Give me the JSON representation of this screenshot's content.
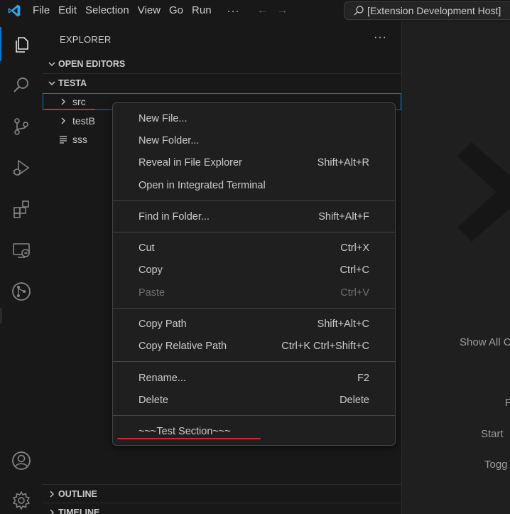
{
  "titlebar": {
    "menus": [
      "File",
      "Edit",
      "Selection",
      "View",
      "Go",
      "Run"
    ],
    "more": "···",
    "back": "←",
    "forward": "→",
    "command_center": "[Extension Development Host]"
  },
  "activitybar": {
    "items": [
      "explorer-icon",
      "search-icon",
      "source-control-icon",
      "run-debug-icon",
      "extensions-icon",
      "remote-explorer-icon",
      "git-graph-icon"
    ],
    "bottom": [
      "account-icon",
      "manage-gear-icon"
    ]
  },
  "sidebar": {
    "title": "EXPLORER",
    "more": "···",
    "open_editors": "OPEN EDITORS",
    "workspace": "TESTA",
    "tree": [
      {
        "name": "src",
        "type": "folder"
      },
      {
        "name": "testB",
        "type": "folder"
      },
      {
        "name": "sss",
        "type": "file"
      }
    ],
    "outline": "OUTLINE",
    "timeline": "TIMELINE"
  },
  "context_menu": {
    "groups": [
      [
        {
          "label": "New File...",
          "shortcut": ""
        },
        {
          "label": "New Folder...",
          "shortcut": ""
        },
        {
          "label": "Reveal in File Explorer",
          "shortcut": "Shift+Alt+R"
        },
        {
          "label": "Open in Integrated Terminal",
          "shortcut": ""
        }
      ],
      [
        {
          "label": "Find in Folder...",
          "shortcut": "Shift+Alt+F"
        }
      ],
      [
        {
          "label": "Cut",
          "shortcut": "Ctrl+X"
        },
        {
          "label": "Copy",
          "shortcut": "Ctrl+C"
        },
        {
          "label": "Paste",
          "shortcut": "Ctrl+V",
          "disabled": true
        }
      ],
      [
        {
          "label": "Copy Path",
          "shortcut": "Shift+Alt+C"
        },
        {
          "label": "Copy Relative Path",
          "shortcut": "Ctrl+K Ctrl+Shift+C"
        }
      ],
      [
        {
          "label": "Rename...",
          "shortcut": "F2"
        },
        {
          "label": "Delete",
          "shortcut": "Delete"
        }
      ],
      [
        {
          "label": "~~~Test Section~~~",
          "shortcut": ""
        }
      ]
    ]
  },
  "editor": {
    "hints": [
      "Show All C",
      "F",
      "Start",
      "Togg"
    ]
  },
  "colors": {
    "accent": "#0078d4",
    "annotation_red": "#e0202a"
  }
}
